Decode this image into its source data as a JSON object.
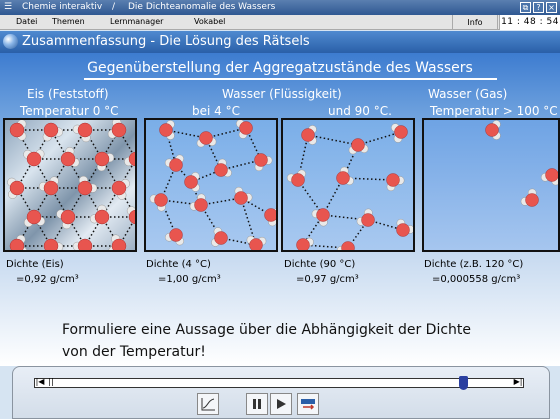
{
  "window": {
    "app_title": "Chemie interaktiv",
    "separator": "/",
    "doc_title": "Die Dichteanomalie des Wassers"
  },
  "menu": {
    "items": [
      "Datei",
      "Themen",
      "Lernmanager",
      "Vokabel"
    ],
    "info": "Info",
    "clock": "11 : 48 : 54"
  },
  "section": {
    "title": "Zusammenfassung - Die Lösung des Rätsels"
  },
  "heading": "Gegenüberstellung der Aggregatzustände des Wassers",
  "states": {
    "ice_title": "Eis (Feststoff)",
    "ice_temp": "Temperatur 0 °C",
    "liquid_title": "Wasser (Flüssigkeit)",
    "liquid_temp4": "bei 4 °C",
    "liquid_temp90": "und 90 °C.",
    "gas_title": "Wasser  (Gas)",
    "gas_temp": "Temperatur > 100 °C"
  },
  "densities": [
    {
      "label": "Dichte (Eis)",
      "value": "=0,92 g/cm³"
    },
    {
      "label": "Dichte (4 °C)",
      "value": "=1,00 g/cm³"
    },
    {
      "label": "Dichte (90 °C)",
      "value": "=0,97 g/cm³"
    },
    {
      "label": "Dichte (z.B. 120 °C)",
      "value": "=0,000558 g/cm³"
    }
  ],
  "task": {
    "line1": "Formuliere eine Aussage über die Abhängigkeit der Dichte",
    "line2": "von der Temperatur!"
  },
  "player": {
    "position": 0.89
  },
  "colors": {
    "oxygen": "#e8554f",
    "hydrogen": "#e9e9e9",
    "accent": "#2a5fa8"
  }
}
